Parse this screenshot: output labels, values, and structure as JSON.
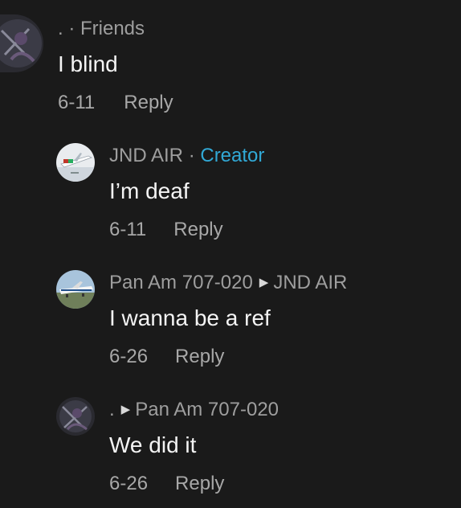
{
  "comments": [
    {
      "user": ". · Friends",
      "text": "I blind",
      "date": "6-11",
      "reply_label": "Reply",
      "avatar_icon": "user-avatar-dark"
    },
    {
      "user": "JND AIR",
      "separator": "·",
      "badge": "Creator",
      "text": "I’m deaf",
      "date": "6-11",
      "reply_label": "Reply",
      "avatar_icon": "airplane-avatar"
    },
    {
      "user": "Pan Am 707-020",
      "reply_to": "JND AIR",
      "text": "I wanna be a ref",
      "date": "6-26",
      "reply_label": "Reply",
      "avatar_icon": "airliner-photo-avatar"
    },
    {
      "user": ".",
      "reply_to": "Pan Am 707-020",
      "text": "We did it",
      "date": "6-26",
      "reply_label": "Reply",
      "avatar_icon": "user-avatar-dark"
    }
  ],
  "colors": {
    "background": "#1a1a1a",
    "creator_badge": "#31a9d6",
    "secondary_text": "#9e9e9e"
  }
}
